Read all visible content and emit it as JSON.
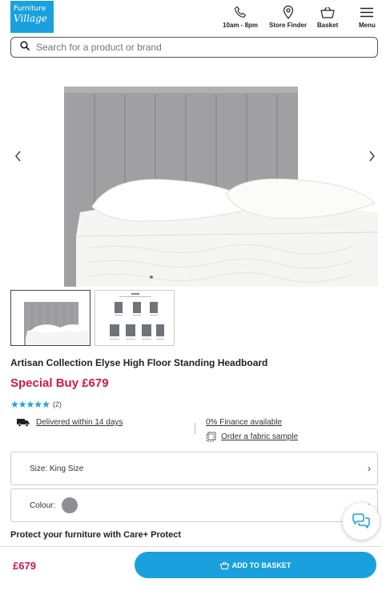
{
  "header": {
    "logo": {
      "line1": "Furniture",
      "line2": "Village"
    },
    "nav": [
      {
        "label": "10am - 8pm",
        "icon": "phone-icon"
      },
      {
        "label": "Store Finder",
        "icon": "location-pin-icon"
      },
      {
        "label": "Basket",
        "icon": "basket-icon"
      },
      {
        "label": "Menu",
        "icon": "hamburger-menu-icon"
      }
    ]
  },
  "search": {
    "placeholder": "Search for a product or brand"
  },
  "product": {
    "title": "Artisan Collection Elyse High Floor Standing Headboard",
    "price": "Special Buy £679",
    "rating": {
      "stars": 5,
      "count": "(2)"
    },
    "delivery": "Delivered within 14 days",
    "finance": "0% Finance available",
    "fabric_sample": "Order a fabric sample"
  },
  "options": {
    "size": "Size: King Size",
    "colour_label": "Colour:",
    "colour_swatch": "#8f8f93"
  },
  "protect": "Protect your furniture with Care+ Protect",
  "footer": {
    "price": "£679",
    "add_button": "ADD TO BASKET"
  },
  "colors": {
    "brand_blue": "#1aa0dc",
    "price_pink": "#d1174f"
  }
}
